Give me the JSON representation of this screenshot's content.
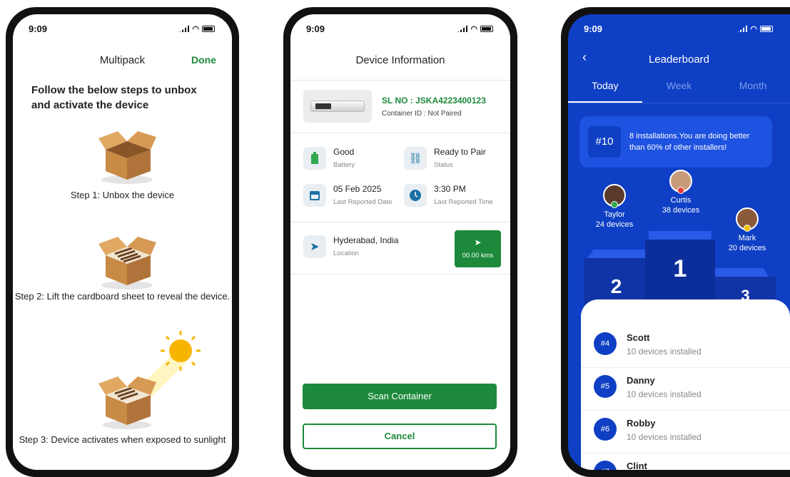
{
  "status_time": "9:09",
  "multipack": {
    "title": "Multipack",
    "done_label": "Done",
    "heading": "Follow the below steps to unbox and activate the device",
    "steps": [
      {
        "text": "Step 1: Unbox the device"
      },
      {
        "text": "Step 2:  Lift the cardboard sheet to reveal the device."
      },
      {
        "text": "Step 3: Device activates when exposed to sunlight"
      }
    ]
  },
  "device": {
    "title": "Device Information",
    "serial": "SL NO : JSKA4223400123",
    "container": "Container ID : Not Paired",
    "battery_value": "Good",
    "battery_label": "Battery",
    "status_value": "Ready to Pair",
    "status_label": "Status",
    "date_value": "05 Feb 2025",
    "date_label": "Last Reported Date",
    "time_value": "3:30 PM",
    "time_label": "Last Reported Time",
    "location_value": "Hyderabad, India",
    "location_label": "Location",
    "distance": "00.00 kms",
    "scan_label": "Scan Container",
    "cancel_label": "Cancel",
    "accent": "#1c8a3a"
  },
  "leaderboard": {
    "title": "Leaderboard",
    "tabs": [
      "Today",
      "Week",
      "Month"
    ],
    "active_tab": "Today",
    "my_rank": "#10",
    "my_text": "8 installations.You are doing better than 60% of other installers!",
    "podium": [
      {
        "place": "2",
        "name": "Taylor",
        "devices": "24 devices"
      },
      {
        "place": "1",
        "name": "Curtis",
        "devices": "38 devices"
      },
      {
        "place": "3",
        "name": "Mark",
        "devices": "20 devices"
      }
    ],
    "list": [
      {
        "rank": "#4",
        "name": "Scott",
        "sub": "10 devices installed"
      },
      {
        "rank": "#5",
        "name": "Danny",
        "sub": "10 devices installed"
      },
      {
        "rank": "#6",
        "name": "Robby",
        "sub": "10 devices installed"
      },
      {
        "rank": "#7",
        "name": "Clint",
        "sub": ""
      }
    ],
    "accent": "#0e3fc4"
  }
}
